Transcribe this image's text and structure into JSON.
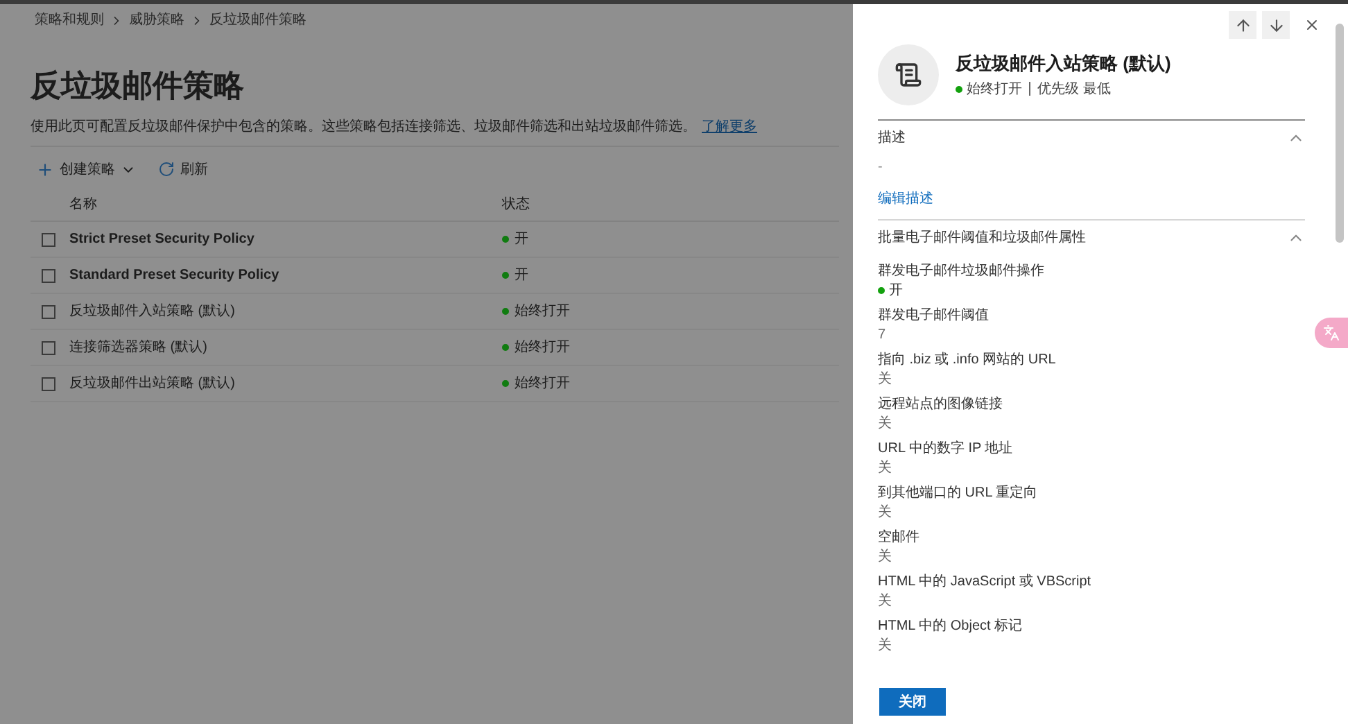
{
  "breadcrumb": [
    "策略和规则",
    "威胁策略",
    "反垃圾邮件策略"
  ],
  "page_title": "反垃圾邮件策略",
  "description": {
    "text": "使用此页可配置反垃圾邮件保护中包含的策略。这些策略包括连接筛选、垃圾邮件筛选和出站垃圾邮件筛选。",
    "link": "了解更多"
  },
  "toolbar": {
    "create": "创建策略",
    "refresh": "刷新"
  },
  "table": {
    "columns": [
      "名称",
      "状态"
    ],
    "rows": [
      {
        "name": "Strict Preset Security Policy",
        "status": "开",
        "color": "#107c10",
        "checked": false
      },
      {
        "name": "Standard Preset Security Policy",
        "status": "开",
        "color": "#107c10",
        "checked": false
      },
      {
        "name": "反垃圾邮件入站策略 (默认)",
        "status": "始终打开",
        "color": "#107c10",
        "checked": false
      },
      {
        "name": "连接筛选器策略 (默认)",
        "status": "始终打开",
        "color": "#107c10",
        "checked": false
      },
      {
        "name": "反垃圾邮件出站策略 (默认)",
        "status": "始终打开",
        "color": "#107c10",
        "checked": false
      }
    ]
  },
  "panel": {
    "title": "反垃圾邮件入站策略 (默认)",
    "status": "始终打开",
    "priority": "优先级 最低",
    "sections": [
      {
        "title": "描述",
        "expanded": true,
        "value": "-",
        "link": "编辑描述"
      },
      {
        "title": "批量电子邮件阈值和垃圾邮件属性",
        "expanded": true,
        "fields": [
          {
            "label": "群发电子邮件垃圾邮件操作",
            "value": "开",
            "kind": "status"
          },
          {
            "label": "群发电子邮件阈值",
            "value": "7",
            "kind": "text"
          },
          {
            "label": "指向 .biz 或 .info 网站的 URL",
            "value": "关",
            "kind": "text"
          },
          {
            "label": "远程站点的图像链接",
            "value": "关",
            "kind": "text"
          },
          {
            "label": "URL 中的数字 IP 地址",
            "value": "关",
            "kind": "text"
          },
          {
            "label": "到其他端口的 URL 重定向",
            "value": "关",
            "kind": "text"
          },
          {
            "label": "空邮件",
            "value": "关",
            "kind": "text"
          },
          {
            "label": "HTML 中的 JavaScript 或 VBScript",
            "value": "关",
            "kind": "text"
          },
          {
            "label": "HTML 中的 Object 标记",
            "value": "关",
            "kind": "text"
          }
        ]
      }
    ],
    "close_button": "关闭"
  }
}
